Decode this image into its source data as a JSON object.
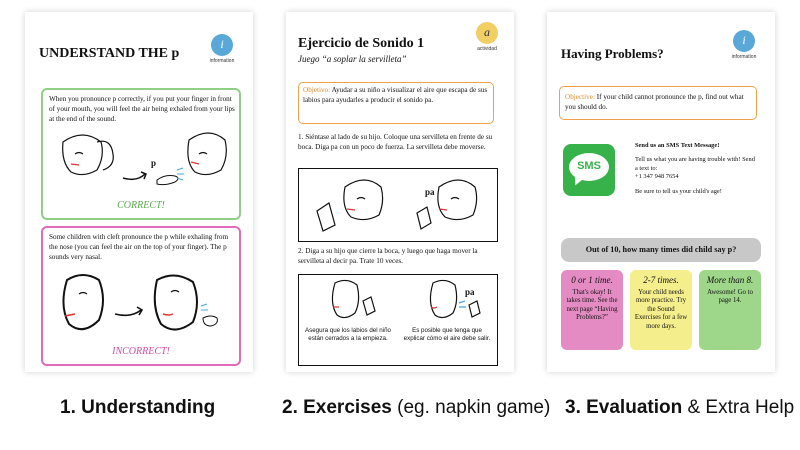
{
  "panel1": {
    "title": "UNDERSTAND THE p",
    "badge_letter": "i",
    "badge_caption": "information",
    "correct_box": {
      "text": "When you pronounce p correctly, if you put your finger in front of your mouth, you will feel the air being exhaled from your lips at the end of the sound.",
      "label": "CORRECT!",
      "p_letter": "p"
    },
    "incorrect_box": {
      "text": "Some children with cleft pronounce the p while exhaling from the nose (you can feel the air on the top of your finger). The p sounds very nasal.",
      "label": "INCORRECT!"
    }
  },
  "panel2": {
    "title": "Ejercicio de Sonido 1",
    "subtitle": "Juego “a soplar la servilleta”",
    "badge_letter": "a",
    "badge_caption": "actividad",
    "objective_label": "Objetivo:",
    "objective_text": "Ayudar a su niño a visualizar el aire que escapa de sus labios para ayudarles a producir el sonido pa.",
    "step1": "1. Siéntase al lado de su hijo. Coloque una servilleta en frente de su boca. Diga pa con un poco de fuerza. La servilleta debe moverse.",
    "step2": "2. Diga a su hijo que cierre la boca, y luego que haga mover la servilleta al decir pa. Trate 10 veces.",
    "pa_label_1": "pa",
    "pa_label_2": "pa",
    "caption_left": "Asegura que los labios del niño están cerrados a la empieza.",
    "caption_right": "Es posible que tenga que explicar cómo el aire debe salir."
  },
  "panel3": {
    "title": "Having Problems?",
    "badge_letter": "i",
    "badge_caption": "information",
    "objective_label": "Objective:",
    "objective_text": "If your child cannot pronounce the p, find out what you should do.",
    "sms_icon_text": "SMS",
    "sms_heading": "Send us an SMS Text Message!",
    "sms_body": "Tell us what you are having trouble with! Send a text to:",
    "sms_phone": "+1 347 948 7654",
    "sms_footer": "Be sure to tell us your child's age!",
    "question": "Out of 10, how many times did child say p?",
    "options": [
      {
        "title": "0 or 1 time.",
        "text": "That's okay! It takes time. See the next page “Having Problems?”",
        "color": "#e58bc3"
      },
      {
        "title": "2-7 times.",
        "text": "Your child needs more practice. Try the Sound Exercises for a few more days.",
        "color": "#f4ee8c"
      },
      {
        "title": "More than 8.",
        "text": "Awesome! Go to page 14.",
        "color": "#9ed68a"
      }
    ]
  },
  "captions": [
    {
      "bold": "1. Understanding",
      "rest": ""
    },
    {
      "bold": "2. Exercises",
      "rest": " (eg. napkin game)"
    },
    {
      "bold": "3. Evaluation",
      "rest": " & Extra Help"
    }
  ],
  "colors": {
    "correct_green": "#8fcf86",
    "incorrect_pink": "#e06bb8",
    "orange": "#f0a14a",
    "sms_green": "#37b24a",
    "info_blue": "#5aa8d8",
    "activity_yellow": "#f2cf64"
  }
}
